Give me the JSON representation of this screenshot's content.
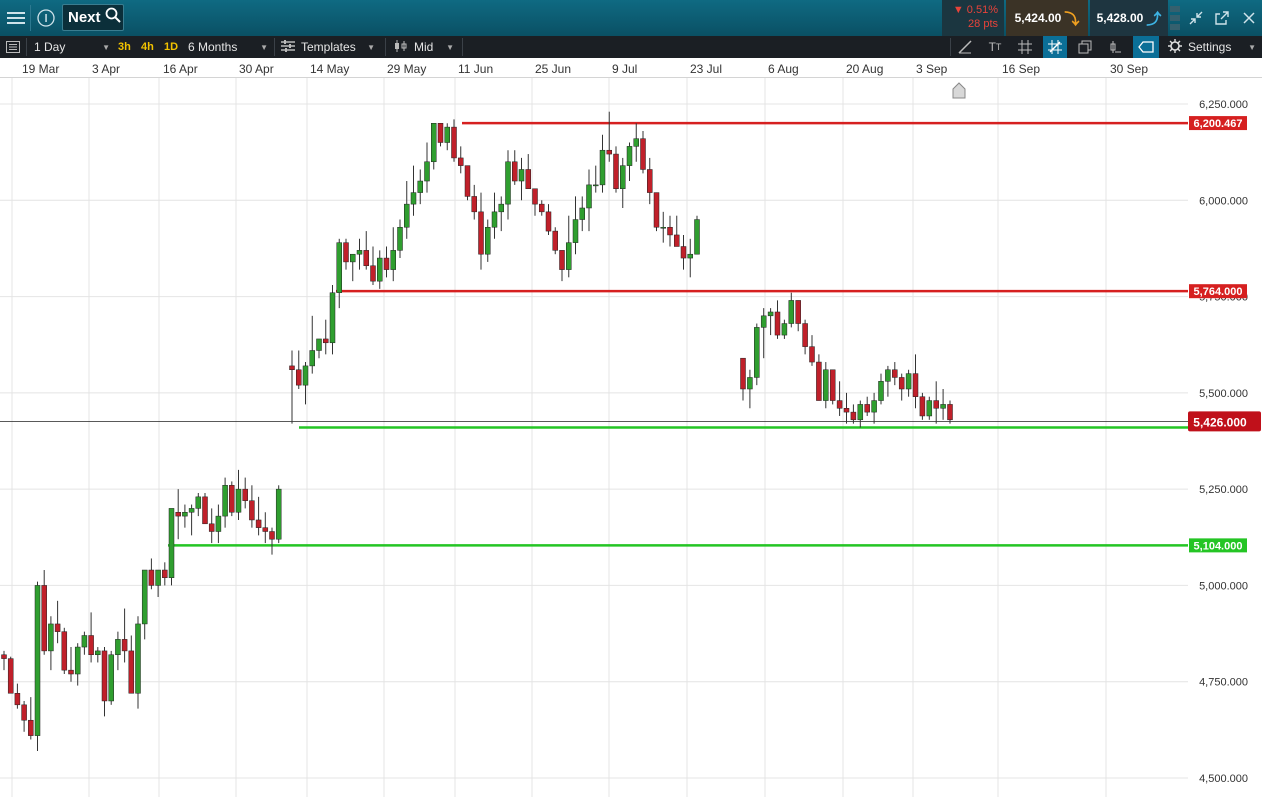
{
  "topbar": {
    "instrument_name": "Next",
    "price_change": {
      "percent": "0.51%",
      "points": "28 pts",
      "direction": "down"
    },
    "sell_price": "5,424.00",
    "buy_price": "5,428.00",
    "colors": {
      "bar_bg": "#0b5a70",
      "negative": "#e8433a",
      "sell_arrow": "#f0a020",
      "buy_arrow": "#3db3e3"
    }
  },
  "toolbar": {
    "interval": "1 Day",
    "quick_intervals": [
      "3h",
      "4h",
      "1D"
    ],
    "range": "6 Months",
    "templates_label": "Templates",
    "price_type": "Mid",
    "settings_label": "Settings"
  },
  "chart_data": {
    "type": "candlestick",
    "x_axis_labels": [
      "19 Mar",
      "3 Apr",
      "16 Apr",
      "30 Apr",
      "14 May",
      "29 May",
      "11 Jun",
      "25 Jun",
      "9 Jul",
      "23 Jul",
      "6 Aug",
      "20 Aug",
      "3 Sep",
      "16 Sep",
      "30 Sep"
    ],
    "y_axis_labels": [
      "6,250.000",
      "6,000.000",
      "5,750.000",
      "5,500.000",
      "5,250.000",
      "5,000.000",
      "4,750.000",
      "4,500.000"
    ],
    "ylim": [
      4500,
      6250
    ],
    "current_price": "5,426.000",
    "horizontal_lines": [
      {
        "label": "6,200.467",
        "value": 6200.467,
        "color": "#d62020"
      },
      {
        "label": "5,764.000",
        "value": 5764,
        "color": "#d62020"
      },
      {
        "label": "5,410.000",
        "value": 5410,
        "color": "#24c524",
        "show_label": false
      },
      {
        "label": "5,104.000",
        "value": 5104,
        "color": "#24c524"
      }
    ],
    "candles": [
      [
        4820,
        4830,
        4780,
        4810
      ],
      [
        4810,
        4815,
        4740,
        4720
      ],
      [
        4720,
        4745,
        4680,
        4690
      ],
      [
        4690,
        4700,
        4620,
        4650
      ],
      [
        4650,
        4710,
        4600,
        4610
      ],
      [
        4610,
        5010,
        4570,
        5000
      ],
      [
        5000,
        5040,
        4820,
        4830
      ],
      [
        4830,
        4920,
        4780,
        4900
      ],
      [
        4900,
        4960,
        4850,
        4880
      ],
      [
        4880,
        4890,
        4770,
        4780
      ],
      [
        4780,
        4840,
        4750,
        4770
      ],
      [
        4770,
        4850,
        4740,
        4840
      ],
      [
        4840,
        4880,
        4820,
        4870
      ],
      [
        4870,
        4930,
        4800,
        4820
      ],
      [
        4820,
        4840,
        4800,
        4830
      ],
      [
        4830,
        4840,
        4660,
        4700
      ],
      [
        4700,
        4830,
        4690,
        4820
      ],
      [
        4820,
        4880,
        4780,
        4860
      ],
      [
        4860,
        4940,
        4800,
        4830
      ],
      [
        4830,
        4870,
        4720,
        4720
      ],
      [
        4720,
        4920,
        4680,
        4900
      ],
      [
        4900,
        5040,
        4860,
        5040
      ],
      [
        5040,
        5070,
        4990,
        5000
      ],
      [
        5000,
        5040,
        4970,
        5040
      ],
      [
        5040,
        5060,
        5000,
        5020
      ],
      [
        5020,
        5190,
        5000,
        5200
      ],
      [
        5190,
        5250,
        5120,
        5180
      ],
      [
        5180,
        5210,
        5150,
        5190
      ],
      [
        5190,
        5210,
        5130,
        5200
      ],
      [
        5200,
        5240,
        5180,
        5230
      ],
      [
        5230,
        5240,
        5160,
        5160
      ],
      [
        5160,
        5200,
        5110,
        5140
      ],
      [
        5140,
        5210,
        5110,
        5180
      ],
      [
        5180,
        5280,
        5150,
        5260
      ],
      [
        5260,
        5270,
        5180,
        5190
      ],
      [
        5190,
        5300,
        5170,
        5250
      ],
      [
        5250,
        5280,
        5200,
        5220
      ],
      [
        5220,
        5260,
        5150,
        5170
      ],
      [
        5170,
        5230,
        5130,
        5150
      ],
      [
        5150,
        5190,
        5110,
        5140
      ],
      [
        5140,
        5150,
        5080,
        5120
      ],
      [
        5120,
        5260,
        5110,
        5250
      ],
      [
        5570,
        5610,
        5420,
        5560
      ],
      [
        5560,
        5610,
        5510,
        5520
      ],
      [
        5520,
        5580,
        5470,
        5570
      ],
      [
        5570,
        5700,
        5550,
        5610
      ],
      [
        5610,
        5630,
        5590,
        5640
      ],
      [
        5640,
        5690,
        5600,
        5630
      ],
      [
        5630,
        5780,
        5600,
        5760
      ],
      [
        5760,
        5900,
        5720,
        5890
      ],
      [
        5890,
        5900,
        5820,
        5840
      ],
      [
        5840,
        5860,
        5790,
        5860
      ],
      [
        5860,
        5900,
        5820,
        5870
      ],
      [
        5870,
        5920,
        5820,
        5830
      ],
      [
        5830,
        5880,
        5780,
        5790
      ],
      [
        5790,
        5870,
        5770,
        5850
      ],
      [
        5850,
        5880,
        5800,
        5820
      ],
      [
        5820,
        5930,
        5790,
        5870
      ],
      [
        5870,
        5950,
        5850,
        5930
      ],
      [
        5930,
        6050,
        5900,
        5990
      ],
      [
        5990,
        6090,
        5960,
        6020
      ],
      [
        6020,
        6080,
        5990,
        6050
      ],
      [
        6050,
        6150,
        6020,
        6100
      ],
      [
        6100,
        6200,
        6080,
        6200
      ],
      [
        6200,
        6200,
        6140,
        6150
      ],
      [
        6150,
        6200,
        6130,
        6190
      ],
      [
        6190,
        6210,
        6100,
        6110
      ],
      [
        6110,
        6140,
        6070,
        6090
      ],
      [
        6090,
        6080,
        6000,
        6010
      ],
      [
        6010,
        6040,
        5950,
        5970
      ],
      [
        5970,
        6020,
        5820,
        5860
      ],
      [
        5860,
        5950,
        5840,
        5930
      ],
      [
        5930,
        6020,
        5900,
        5970
      ],
      [
        5970,
        6010,
        5920,
        5990
      ],
      [
        5990,
        6130,
        5950,
        6100
      ],
      [
        6100,
        6130,
        6040,
        6050
      ],
      [
        6050,
        6110,
        6000,
        6080
      ],
      [
        6080,
        6120,
        6050,
        6030
      ],
      [
        6030,
        6020,
        5960,
        5990
      ],
      [
        5990,
        6000,
        5960,
        5970
      ],
      [
        5970,
        5990,
        5910,
        5920
      ],
      [
        5920,
        5930,
        5860,
        5870
      ],
      [
        5870,
        5860,
        5790,
        5820
      ],
      [
        5820,
        5960,
        5800,
        5890
      ],
      [
        5890,
        6010,
        5860,
        5950
      ],
      [
        5950,
        6010,
        5920,
        5980
      ],
      [
        5980,
        6080,
        5920,
        6040
      ],
      [
        6040,
        6090,
        6020,
        6040
      ],
      [
        6040,
        6170,
        6020,
        6130
      ],
      [
        6130,
        6230,
        6100,
        6120
      ],
      [
        6120,
        6140,
        6020,
        6030
      ],
      [
        6030,
        6110,
        5980,
        6090
      ],
      [
        6090,
        6150,
        6050,
        6140
      ],
      [
        6140,
        6200,
        6100,
        6160
      ],
      [
        6160,
        6180,
        6070,
        6080
      ],
      [
        6080,
        6110,
        5990,
        6020
      ],
      [
        6020,
        6020,
        5920,
        5930
      ],
      [
        5930,
        5970,
        5890,
        5930
      ],
      [
        5930,
        5960,
        5880,
        5910
      ],
      [
        5910,
        5960,
        5880,
        5880
      ],
      [
        5880,
        5910,
        5820,
        5850
      ],
      [
        5850,
        5900,
        5800,
        5860
      ],
      [
        5860,
        5960,
        5860,
        5950
      ],
      [
        5590,
        5590,
        5480,
        5510
      ],
      [
        5510,
        5560,
        5460,
        5540
      ],
      [
        5540,
        5680,
        5520,
        5670
      ],
      [
        5670,
        5720,
        5590,
        5700
      ],
      [
        5700,
        5720,
        5650,
        5710
      ],
      [
        5710,
        5740,
        5640,
        5650
      ],
      [
        5650,
        5690,
        5640,
        5680
      ],
      [
        5680,
        5760,
        5670,
        5740
      ],
      [
        5740,
        5740,
        5660,
        5680
      ],
      [
        5680,
        5690,
        5600,
        5620
      ],
      [
        5620,
        5650,
        5570,
        5580
      ],
      [
        5580,
        5600,
        5480,
        5480
      ],
      [
        5480,
        5580,
        5460,
        5560
      ],
      [
        5560,
        5560,
        5470,
        5480
      ],
      [
        5480,
        5530,
        5440,
        5460
      ],
      [
        5460,
        5500,
        5420,
        5450
      ],
      [
        5450,
        5470,
        5420,
        5430
      ],
      [
        5430,
        5480,
        5410,
        5470
      ],
      [
        5470,
        5490,
        5440,
        5450
      ],
      [
        5450,
        5500,
        5420,
        5480
      ],
      [
        5480,
        5550,
        5470,
        5530
      ],
      [
        5530,
        5570,
        5490,
        5560
      ],
      [
        5560,
        5580,
        5520,
        5540
      ],
      [
        5540,
        5550,
        5480,
        5510
      ],
      [
        5510,
        5560,
        5490,
        5550
      ],
      [
        5550,
        5600,
        5460,
        5490
      ],
      [
        5490,
        5500,
        5430,
        5440
      ],
      [
        5440,
        5490,
        5430,
        5480
      ],
      [
        5480,
        5530,
        5420,
        5460
      ],
      [
        5460,
        5510,
        5430,
        5470
      ],
      [
        5470,
        5480,
        5420,
        5430
      ]
    ]
  }
}
